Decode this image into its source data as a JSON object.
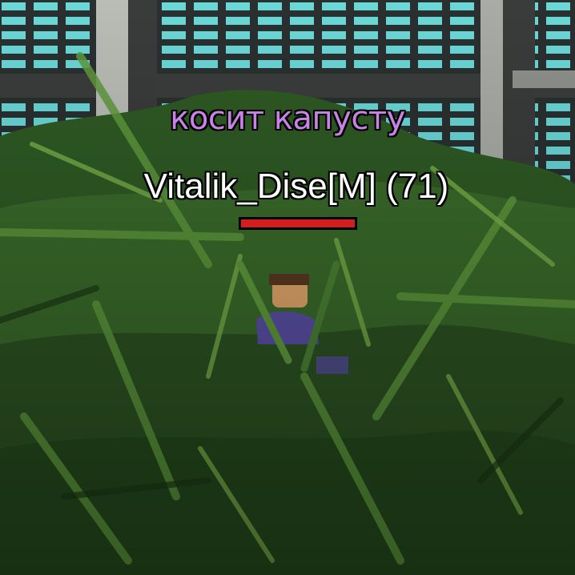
{
  "player": {
    "action_text": "косит капусту",
    "name": "Vitalik_Dise[M]",
    "id_label": "(71)",
    "health_fraction": 1.0
  },
  "colors": {
    "action_text": "#c983e6",
    "name_text": "#ffffff",
    "health_fill": "#d21e1e",
    "window_glass": "#6ad8d8",
    "frame": "#4a4a4a",
    "foliage": "#2f5a24"
  },
  "icons": [
    "player-character",
    "foliage-plants",
    "greenhouse-window-grid"
  ]
}
